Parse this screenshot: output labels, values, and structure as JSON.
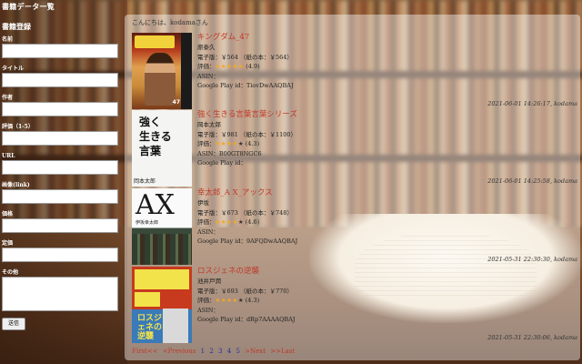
{
  "site_title": "書籍データ一覧",
  "form": {
    "heading": "書籍登録",
    "fields": [
      {
        "label": "名前",
        "value": ""
      },
      {
        "label": "タイトル",
        "value": ""
      },
      {
        "label": "作者",
        "value": ""
      },
      {
        "label": "評価（1-5）",
        "value": ""
      },
      {
        "label": "URL",
        "value": ""
      },
      {
        "label": "画像(link)",
        "value": ""
      },
      {
        "label": "価格",
        "value": ""
      },
      {
        "label": "定価",
        "value": ""
      }
    ],
    "comment_label": "その他",
    "comment_value": "",
    "submit_label": "送信"
  },
  "greeting": "こんにちは、kodamaさん",
  "books": [
    {
      "title": "キングダム_47",
      "author": "原泰久",
      "price": "電子版：￥564 （紙の本：￥564）",
      "rating_label": "評価：",
      "stars": "★★★★★",
      "stars_empty": "",
      "rating": "(4.9)",
      "asin": "ASIN：",
      "gplay": "Google Play id：TiovDwAAQBAJ",
      "stamp": "2021-06-01 14:26:17, kodama",
      "cover": {
        "title": "キングダム",
        "number": "47"
      }
    },
    {
      "title": "強く生きる言葉言葉シリーズ",
      "author": "岡本太郎",
      "price": "電子版：￥981 （紙の本：￥1100）",
      "rating_label": "評価：",
      "stars": "★★★★",
      "stars_empty": "★",
      "rating": "(4.3)",
      "asin": "ASIN：B00GT8NGC6",
      "gplay": "Google Play id：",
      "stamp": "2021-06-01 14:25:58, kodama",
      "cover": {
        "line1": "強く",
        "line2": "生きる",
        "line3": "言葉",
        "author": "岡本太郎"
      }
    },
    {
      "title": "幸太郎_A X_アックス",
      "author": "伊坂",
      "price": "電子版：￥673 （紙の本：￥748）",
      "rating_label": "評価：",
      "stars": "★★★★",
      "stars_empty": "★",
      "rating": "(4.6)",
      "asin": "ASIN：",
      "gplay": "Google Play id：9AFQDwAAQBAJ",
      "stamp": "2021-05-31 22:30:30, kodama",
      "cover": {
        "big": "AX",
        "author": "伊坂幸太郎"
      }
    },
    {
      "title": "ロスジェネの逆襲",
      "author": "池井戸潤",
      "price": "電子版：￥693 （紙の本：￥770）",
      "rating_label": "評価：",
      "stars": "★★★★",
      "stars_empty": "★",
      "rating": "(4.3)",
      "asin": "ASIN：",
      "gplay": "Google Play id：dRp7AAAAQBAJ",
      "stamp": "2021-05-31 22:30:06, kodama",
      "cover": {
        "text": "ロスジェネの逆襲"
      }
    }
  ],
  "pagination": {
    "first": "First<<",
    "previous": "<Previous",
    "pages": [
      "1",
      "2",
      "3",
      "4",
      "5"
    ],
    "next": ">Next",
    "last": ">>Last"
  },
  "colors": {
    "link_red": "#c0392b",
    "page_blue": "#2a2a9a",
    "star": "#f1a920"
  }
}
